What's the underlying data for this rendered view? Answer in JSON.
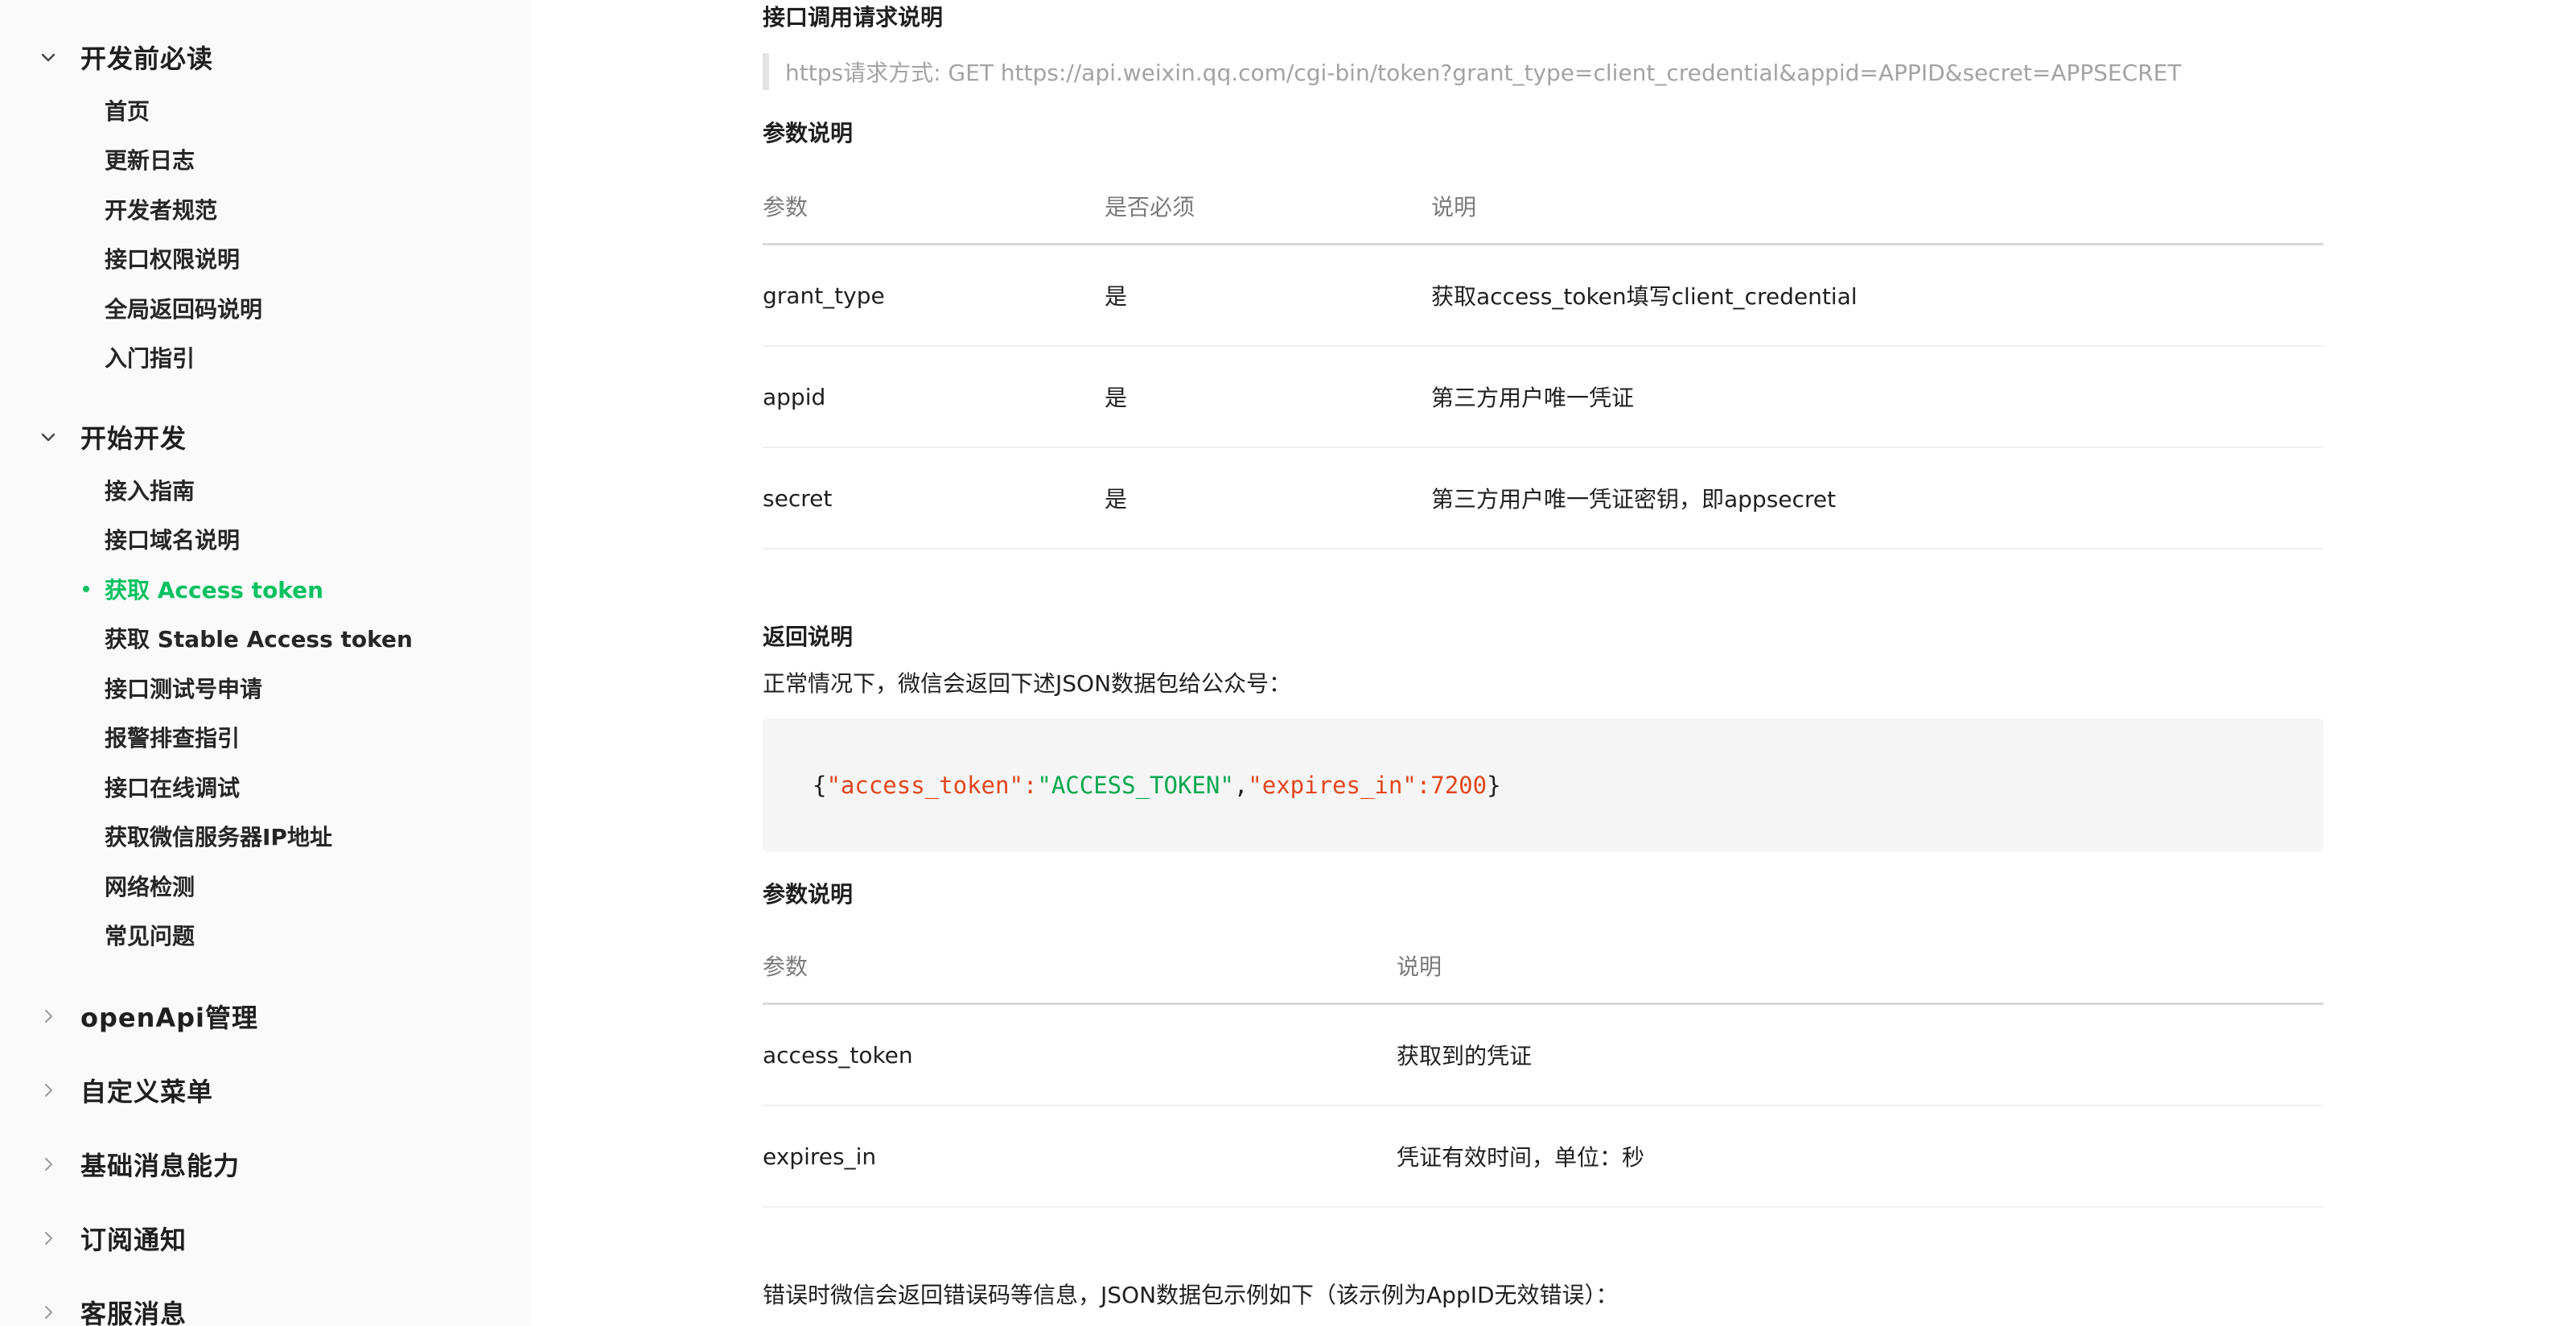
{
  "sidebar": {
    "groups": [
      {
        "title": "开发前必读",
        "expanded": true,
        "items": [
          "首页",
          "更新日志",
          "开发者规范",
          "接口权限说明",
          "全局返回码说明",
          "入门指引"
        ]
      },
      {
        "title": "开始开发",
        "expanded": true,
        "items": [
          "接入指南",
          "接口域名说明",
          "获取 Access token",
          "获取 Stable Access token",
          "接口测试号申请",
          "报警排查指引",
          "接口在线调试",
          "获取微信服务器IP地址",
          "网络检测",
          "常见问题"
        ],
        "active_item": "获取 Access token"
      },
      {
        "title": "openApi管理",
        "expanded": false
      },
      {
        "title": "自定义菜单",
        "expanded": false
      },
      {
        "title": "基础消息能力",
        "expanded": false
      },
      {
        "title": "订阅通知",
        "expanded": false
      },
      {
        "title": "客服消息",
        "expanded": false
      }
    ]
  },
  "main": {
    "request_heading": "接口调用请求说明",
    "request_url": "https请求方式: GET https://api.weixin.qq.com/cgi-bin/token?grant_type=client_credential&appid=APPID&secret=APPSECRET",
    "params_heading_1": "参数说明",
    "params_table": {
      "headers": [
        "参数",
        "是否必须",
        "说明"
      ],
      "rows": [
        [
          "grant_type",
          "是",
          "获取access_token填写client_credential"
        ],
        [
          "appid",
          "是",
          "第三方用户唯一凭证"
        ],
        [
          "secret",
          "是",
          "第三方用户唯一凭证密钥，即appsecret"
        ]
      ]
    },
    "return_heading": "返回说明",
    "return_desc": "正常情况下，微信会返回下述JSON数据包给公众号：",
    "code": {
      "open": "{",
      "k1": "\"access_token\"",
      "colon1": ":",
      "v1": "\"ACCESS_TOKEN\"",
      "comma": ",",
      "k2": "\"expires_in\"",
      "colon2": ":",
      "v2": "7200",
      "close": "}"
    },
    "params_heading_2": "参数说明",
    "return_table": {
      "headers": [
        "参数",
        "说明"
      ],
      "rows": [
        [
          "access_token",
          "获取到的凭证"
        ],
        [
          "expires_in",
          "凭证有效时间，单位：秒"
        ]
      ]
    },
    "error_desc": "错误时微信会返回错误码等信息，JSON数据包示例如下（该示例为AppID无效错误）："
  },
  "colors": {
    "accent": "#07c160",
    "code_key": "#e2461d",
    "code_string": "#07a84f"
  }
}
